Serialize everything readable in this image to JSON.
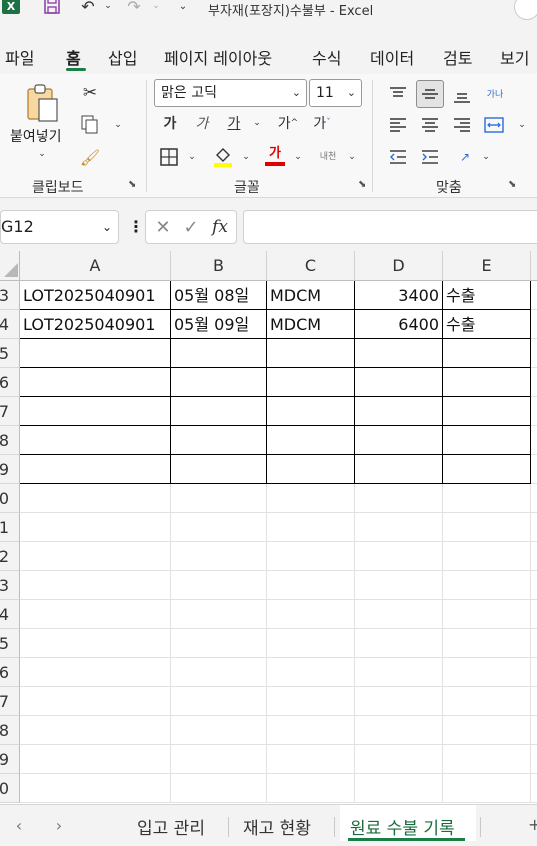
{
  "window": {
    "title": "부자재(포장지)수불부  -  Excel"
  },
  "ribbon_tabs": [
    "파일",
    "홈",
    "삽입",
    "페이지 레이아웃",
    "수식",
    "데이터",
    "검토",
    "보기"
  ],
  "ribbon": {
    "clipboard": {
      "paste_label": "붙여넣기",
      "group_label": "클립보드"
    },
    "font": {
      "font_name": "맑은 고딕",
      "font_size": "11",
      "group_label": "글꼴",
      "bold": "가",
      "italic": "가",
      "underline": "가",
      "grow": "가",
      "shrink": "가",
      "font_color_glyph": "가",
      "phonetic": "내천"
    },
    "alignment": {
      "group_label": "맞춤",
      "wrap": "가나"
    }
  },
  "formula_bar": {
    "name_box": "G12",
    "fx": "fx",
    "formula": ""
  },
  "columns": [
    "A",
    "B",
    "C",
    "D",
    "E"
  ],
  "row_numbers": [
    "3",
    "4",
    "5",
    "6",
    "7",
    "8",
    "9",
    "0",
    "1",
    "2",
    "3",
    "4",
    "5",
    "6",
    "7",
    "8",
    "9",
    "0"
  ],
  "rows": [
    [
      "LOT2025040901",
      "05월 08일",
      "MDCM",
      "3400",
      "수출"
    ],
    [
      "LOT2025040901",
      "05월 09일",
      "MDCM",
      "6400",
      "수출"
    ],
    [
      "",
      "",
      "",
      "",
      ""
    ],
    [
      "",
      "",
      "",
      "",
      ""
    ],
    [
      "",
      "",
      "",
      "",
      ""
    ],
    [
      "",
      "",
      "",
      "",
      ""
    ],
    [
      "",
      "",
      "",
      "",
      ""
    ]
  ],
  "sheet_tabs": [
    "입고 관리",
    "재고 현황",
    "원료 수불 기록"
  ],
  "active_sheet": "원료 수불 기록",
  "colors": {
    "accent": "#1a7f46",
    "highlight": "#ffff00",
    "font_red": "#e00000"
  }
}
